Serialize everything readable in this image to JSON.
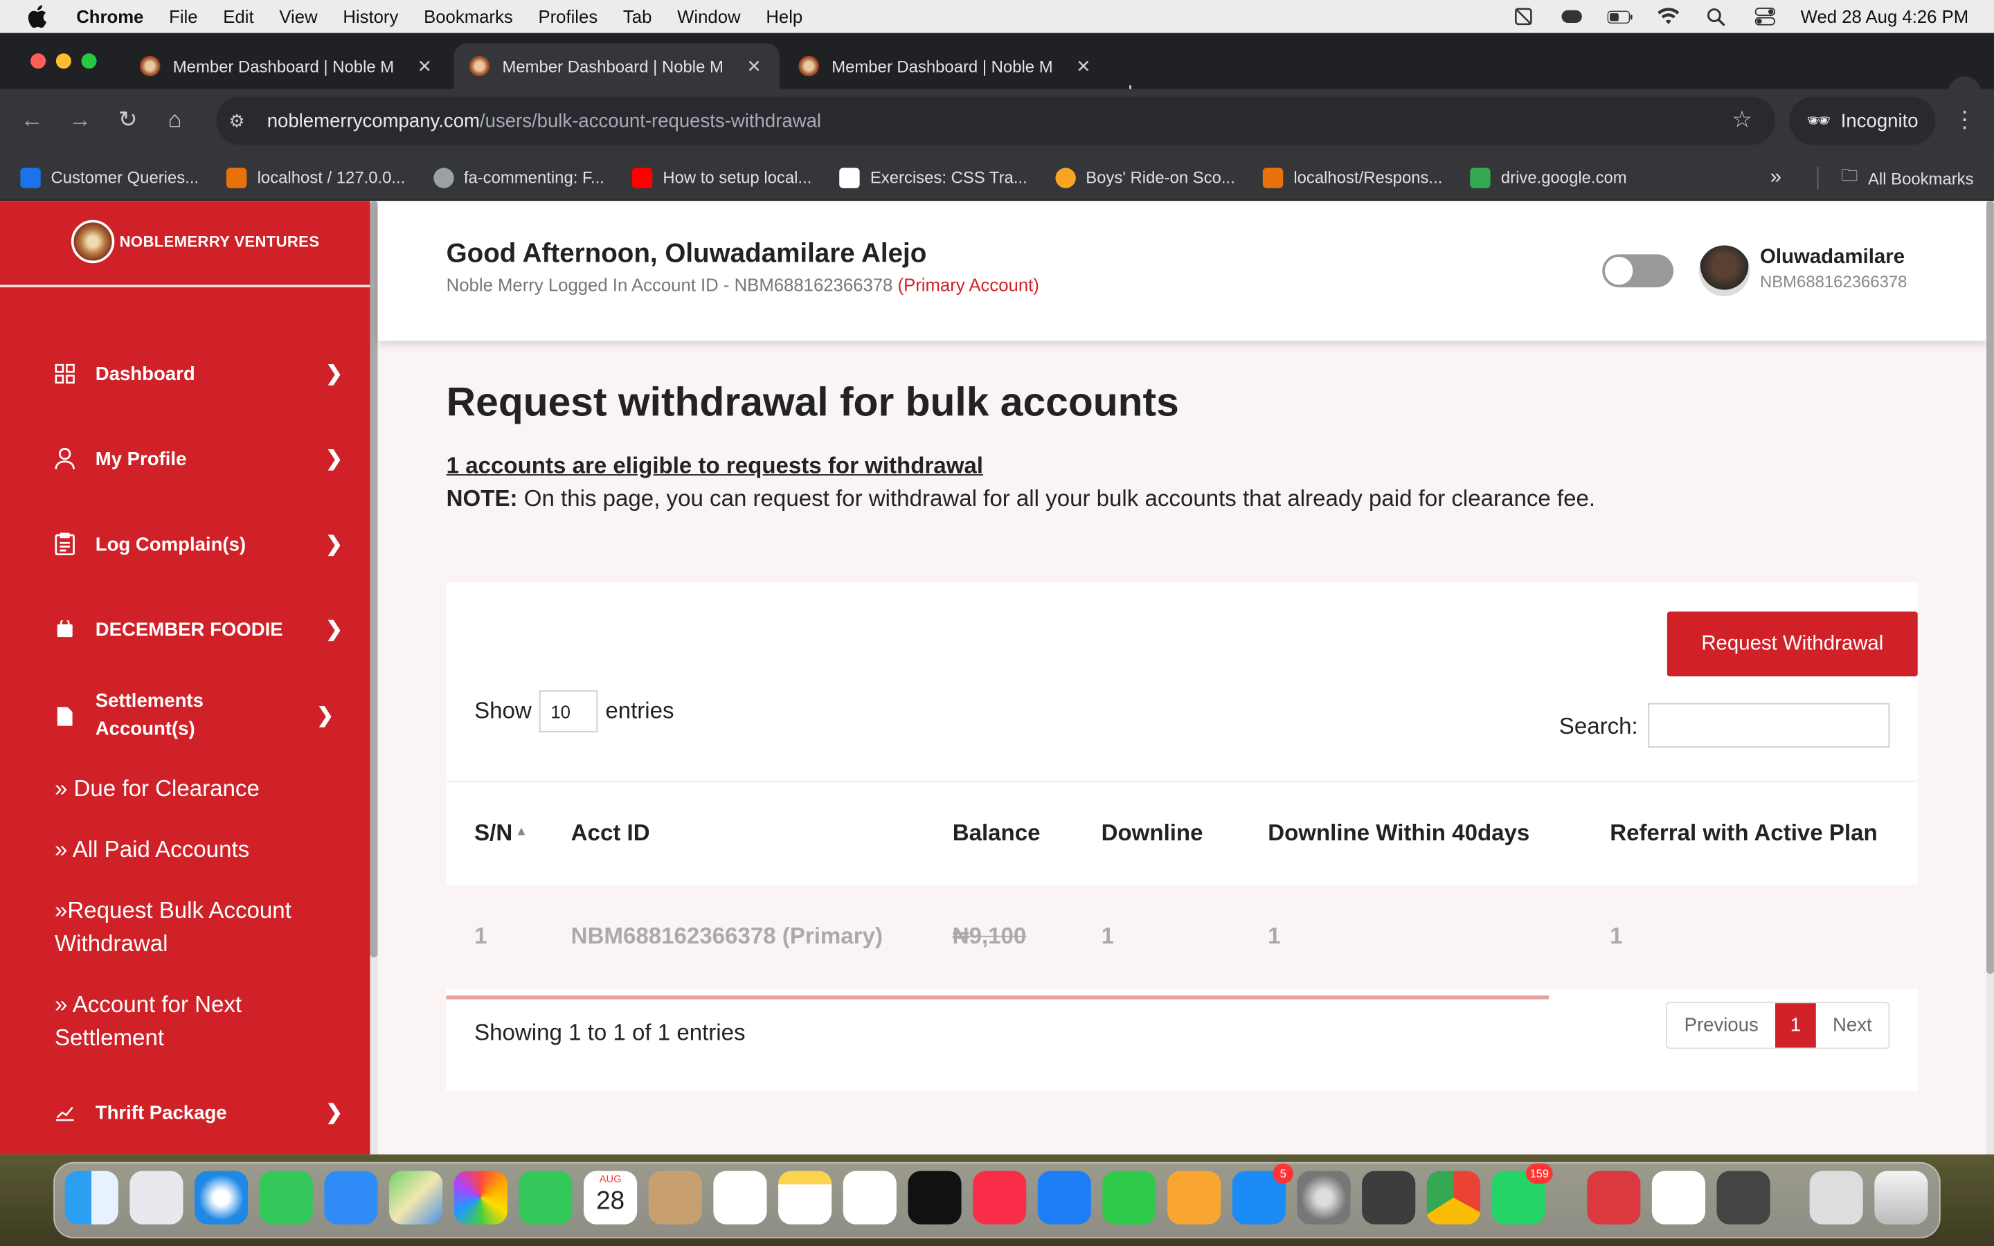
{
  "menubar": {
    "app": "Chrome",
    "items": [
      "File",
      "Edit",
      "View",
      "History",
      "Bookmarks",
      "Profiles",
      "Tab",
      "Window",
      "Help"
    ],
    "clock": "Wed 28 Aug  4:26 PM"
  },
  "browser": {
    "tabs": [
      {
        "title": "Member Dashboard | Noble M"
      },
      {
        "title": "Member Dashboard | Noble M"
      },
      {
        "title": "Member Dashboard | Noble M"
      }
    ],
    "url_host": "noblemerrycompany.com",
    "url_path": "/users/bulk-account-requests-withdrawal",
    "incognito": "Incognito",
    "bookmarks": [
      {
        "label": "Customer Queries...",
        "color": "#1a73e8"
      },
      {
        "label": "localhost / 127.0.0...",
        "color": "#e8710a"
      },
      {
        "label": "fa-commenting: F...",
        "color": "#9aa0a6"
      },
      {
        "label": "How to setup local...",
        "color": "#ff0000"
      },
      {
        "label": "Exercises: CSS Tra...",
        "color": "#ffffff"
      },
      {
        "label": "Boys' Ride-on Sco...",
        "color": "#f6a623"
      },
      {
        "label": "localhost/Respons...",
        "color": "#e8710a"
      },
      {
        "label": "drive.google.com",
        "color": "#34a853"
      }
    ],
    "all_bookmarks": "All Bookmarks"
  },
  "sidebar": {
    "brand": "NOBLEMERRY VENTURES",
    "items": [
      {
        "label": "Dashboard",
        "icon": "grid-icon"
      },
      {
        "label": "My Profile",
        "icon": "user-icon"
      },
      {
        "label": "Log Complain(s)",
        "icon": "clipboard-icon"
      },
      {
        "label": "DECEMBER FOODIE",
        "icon": "bag-icon"
      },
      {
        "label": "Settlements Account(s)",
        "icon": "file-icon"
      }
    ],
    "subitems": [
      "» Due for Clearance",
      "» All Paid Accounts",
      "»Request Bulk Account Withdrawal",
      "» Account for Next Settlement"
    ],
    "thrift": {
      "label": "Thrift Package",
      "icon": "chart-icon"
    }
  },
  "header": {
    "greeting": "Good Afternoon, Oluwadamilare Alejo",
    "account_line": "Noble Merry Logged In Account ID - NBM688162366378",
    "primary_tag": "(Primary Account)",
    "user_name": "Oluwadamilare",
    "user_id": "NBM688162366378"
  },
  "main": {
    "title": "Request withdrawal for bulk accounts",
    "eligible": "1 accounts are eligible to requests for withdrawal",
    "note_label": "NOTE:",
    "note_text": " On this page, you can request for withdrawal for all your bulk accounts that already paid for clearance fee.",
    "request_button": "Request Withdrawal",
    "show_label": "Show",
    "entries_value": "10",
    "entries_label": "entries",
    "search_label": "Search:",
    "search_value": "",
    "columns": [
      "S/N",
      "Acct ID",
      "Balance",
      "Downline",
      "Downline Within 40days",
      "Referral with Active Plan"
    ],
    "rows": [
      [
        "1",
        "NBM688162366378 (Primary)",
        "₦9,100",
        "1",
        "1",
        "1"
      ]
    ],
    "showing": "Showing 1 to 1 of 1 entries",
    "pagination": {
      "previous": "Previous",
      "current": "1",
      "next": "Next"
    }
  },
  "dock": {
    "badges": {
      "appstore": "5",
      "whatsapp": "159"
    },
    "calendar": {
      "month": "AUG",
      "day": "28"
    }
  },
  "colors": {
    "accent": "#cf2127",
    "page_bg": "#fbf4f4"
  }
}
